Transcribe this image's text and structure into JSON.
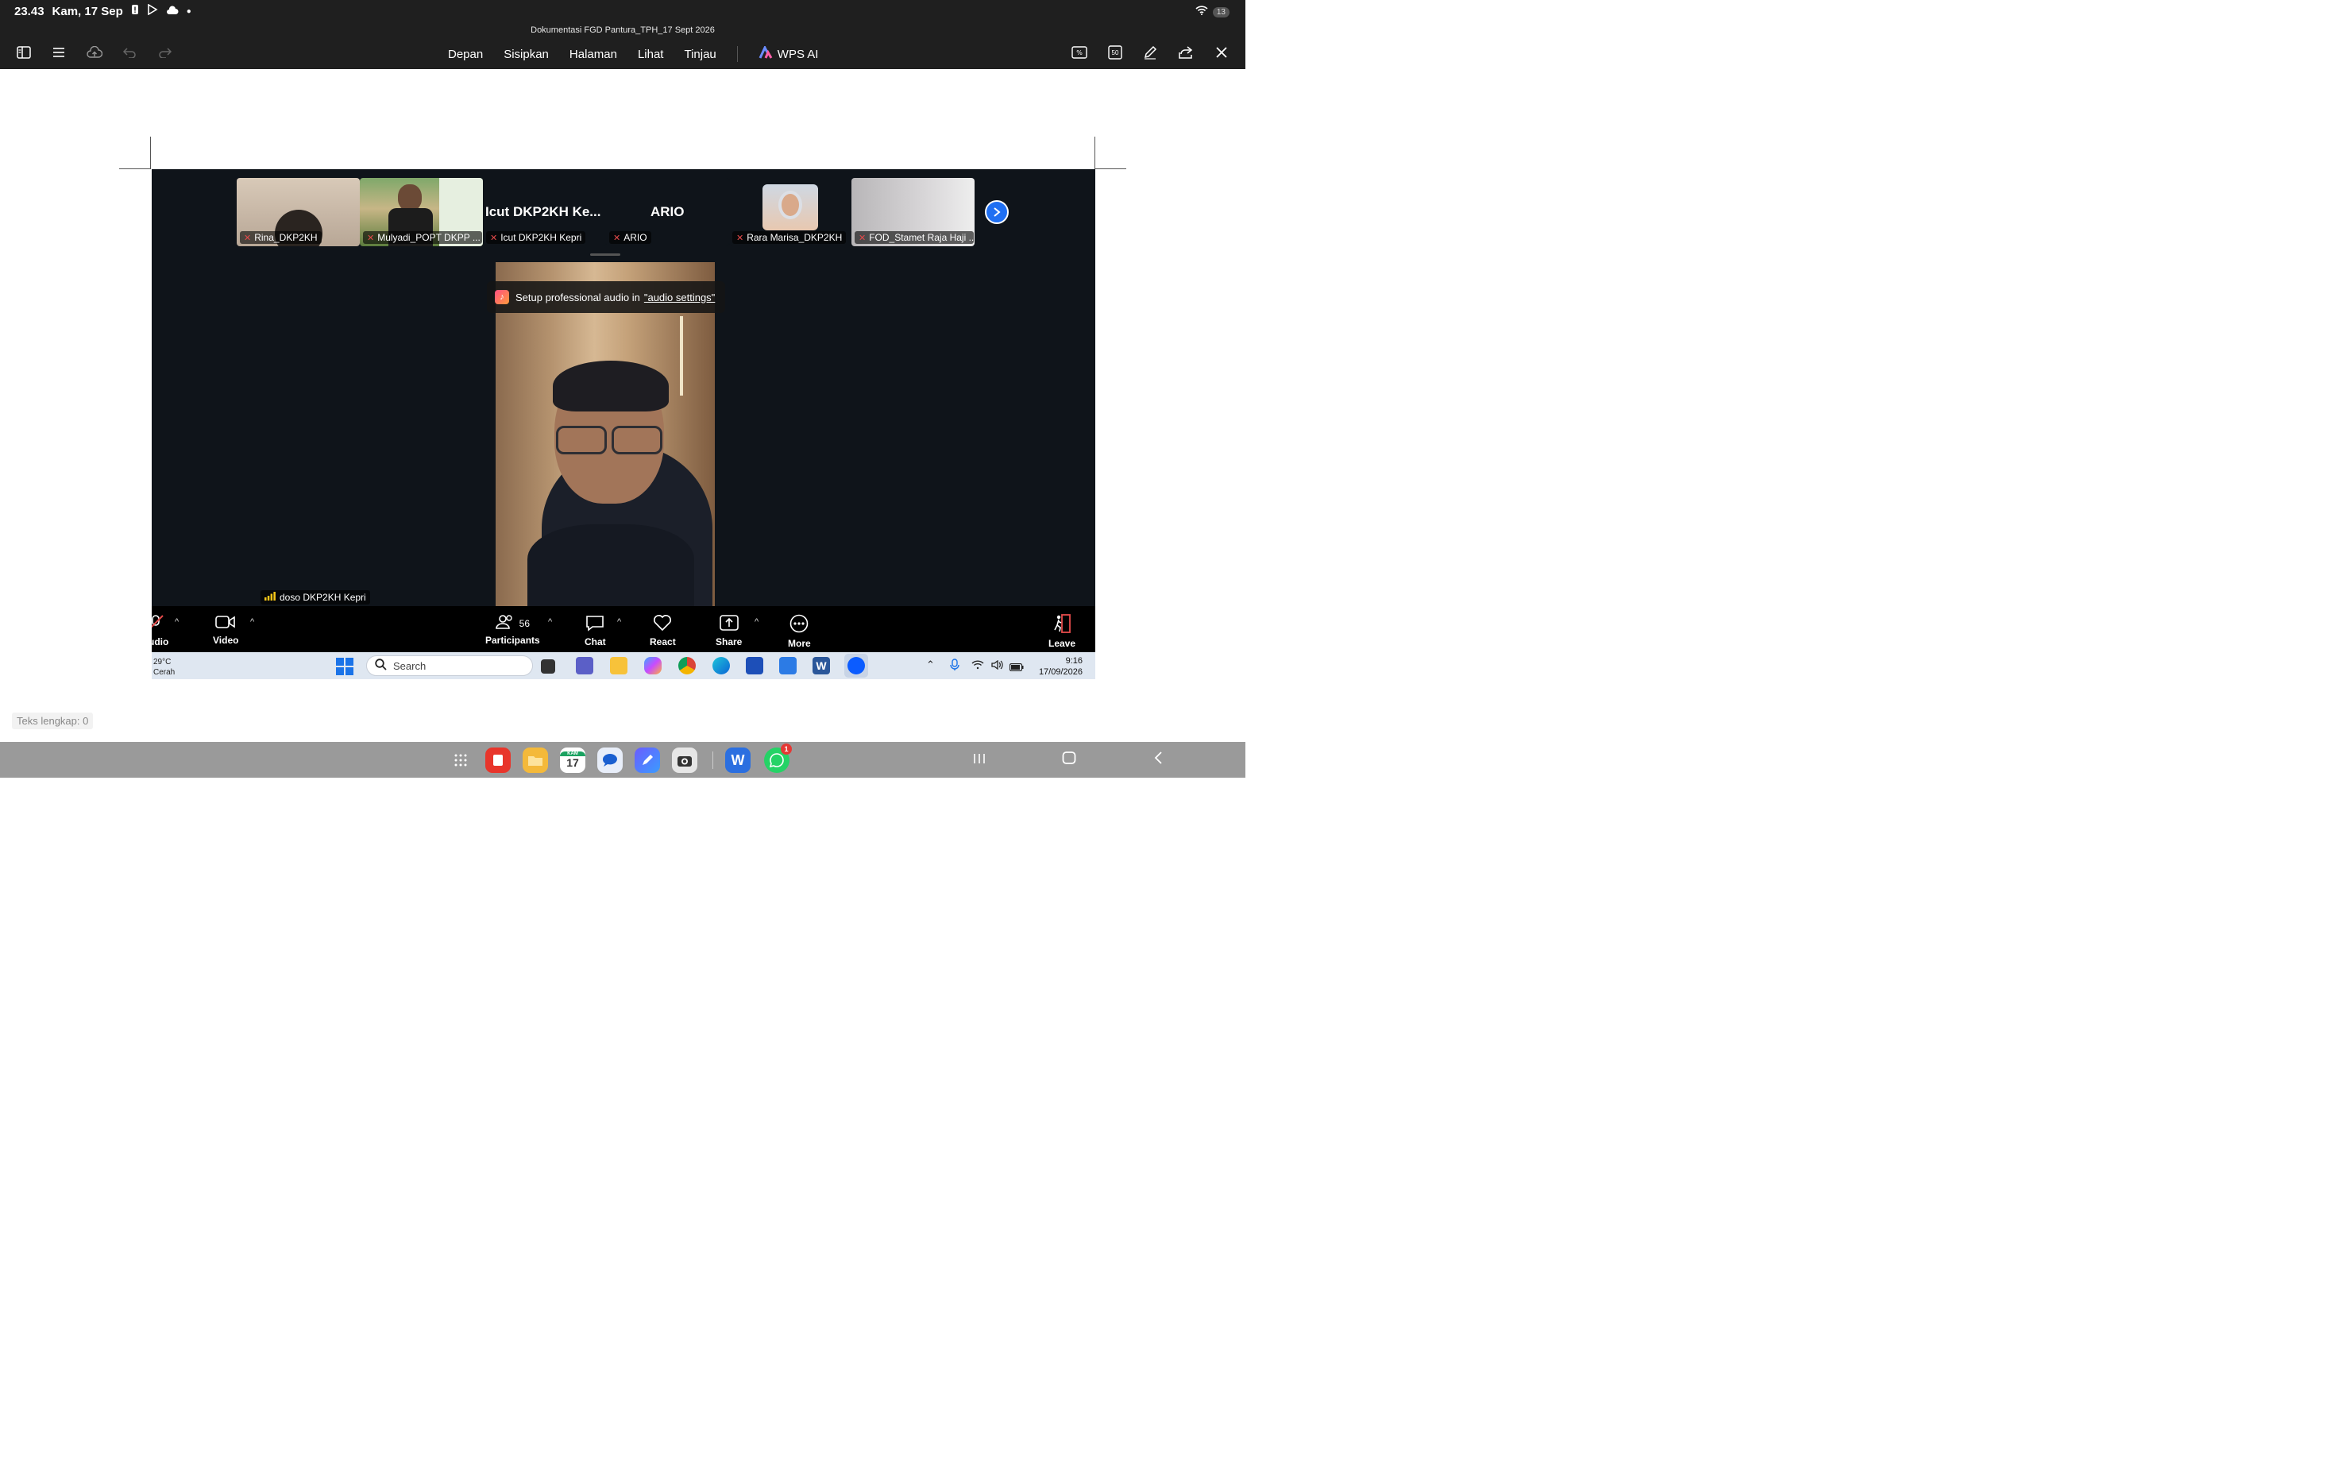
{
  "status_bar": {
    "time": "23.43",
    "date": "Kam, 17 Sep",
    "battery": "13"
  },
  "app": {
    "document_title": "Dokumentasi FGD Pantura_TPH_17 Sept 2026",
    "menu": [
      "Depan",
      "Sisipkan",
      "Halaman",
      "Lihat",
      "Tinjau"
    ],
    "wps_ai": "WPS AI",
    "zoom_level": "50"
  },
  "zoom_meeting": {
    "thumbnails": [
      {
        "label": "Rina_DKP2KH"
      },
      {
        "label": "Mulyadi_POPT DKPP ..."
      },
      {
        "big_name": "Icut DKP2KH Ke...",
        "label": "Icut DKP2KH Kepri"
      },
      {
        "big_name": "ARIO",
        "label": "ARIO"
      },
      {
        "label": "Rara Marisa_DKP2KH"
      },
      {
        "label": "FOD_Stamet Raja Haji ..."
      }
    ],
    "toast": {
      "text": "Setup professional audio in",
      "link": "\"audio settings\""
    },
    "active_speaker": "doso DKP2KH Kepri",
    "toolbar": {
      "audio": "udio",
      "video": "Video",
      "participants": "Participants",
      "participants_count": "56",
      "chat": "Chat",
      "react": "React",
      "share": "Share",
      "more": "More",
      "leave": "Leave"
    },
    "taskbar": {
      "temperature": "29°C",
      "weather": "Cerah",
      "search_placeholder": "Search",
      "clock_time": "9:16",
      "clock_date": "17/09/2026"
    }
  },
  "footer": {
    "word_count": "Teks lengkap: 0"
  },
  "dock": {
    "calendar_day": "17",
    "calendar_month": "KAM",
    "whatsapp_badge": "1"
  }
}
